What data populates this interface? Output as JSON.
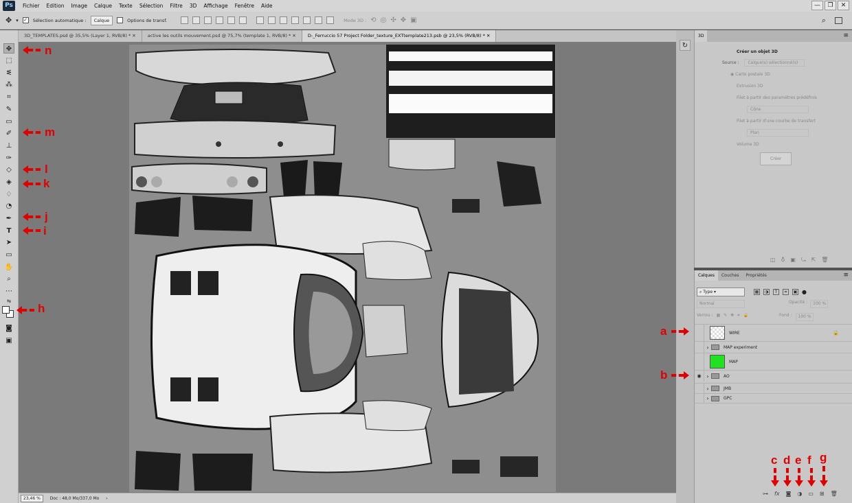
{
  "app": {
    "logo": "Ps"
  },
  "menu": [
    "Fichier",
    "Edition",
    "Image",
    "Calque",
    "Texte",
    "Sélection",
    "Filtre",
    "3D",
    "Affichage",
    "Fenêtre",
    "Aide"
  ],
  "window_controls": [
    "—",
    "❐",
    "✕"
  ],
  "options": {
    "auto_select_label": "Sélection automatique :",
    "auto_select_target": "Calque",
    "transform_label": "Options de transf.",
    "mode3d_label": "Mode 3D :"
  },
  "tabs": [
    {
      "label": "3D_TEMPLATES.psd @ 35,5% (Layer 1, RVB/8) *",
      "active": false
    },
    {
      "label": "active les outils mouvement.psd @ 75,7% (template 1, RVB/8) *",
      "active": false
    },
    {
      "label": "D-_Ferruccio 57 Project Folder_texture_EXTtemplate213.psb @ 23,5% (RVB/8) *",
      "active": true
    }
  ],
  "status": {
    "zoom": "23,46 %",
    "doc": "Doc : 48,0 Mo/337,0 Mo"
  },
  "panel3d": {
    "tab": "3D",
    "title": "Créer un objet 3D",
    "source_label": "Source :",
    "source_value": "Calque(s) sélectionné(s)",
    "options": [
      "Carte postale 3D",
      "Extrusion 3D",
      "Filet à partir des paramètres prédéfinis"
    ],
    "preset_value": "Cône",
    "depth_label": "Filet à partir d'une courbe de transfert",
    "depth_value": "Plan",
    "volume_label": "Volume 3D",
    "create_button": "Créer"
  },
  "layers_panel": {
    "tabs": [
      "Calques",
      "Couches",
      "Propriétés"
    ],
    "filter_type": "Type",
    "blend_mode": "Normal",
    "opacity_label": "Opacité :",
    "opacity_value": "100 %",
    "lock_label": "Verrou :",
    "fill_label": "Fond :",
    "fill_value": "100 %",
    "layers": [
      {
        "name": "WIRE",
        "kind": "thumb",
        "visible": false,
        "locked": true
      },
      {
        "name": "MAP experiment",
        "kind": "group",
        "visible": false
      },
      {
        "name": "MAP",
        "kind": "thumb-green",
        "visible": false
      },
      {
        "name": "AO",
        "kind": "group",
        "visible": true
      },
      {
        "name": "JMB",
        "kind": "group",
        "visible": false
      },
      {
        "name": "GPC",
        "kind": "group",
        "visible": false
      }
    ]
  },
  "annotations": {
    "n": "n",
    "m": "m",
    "l1": "l",
    "k": "k",
    "j": "j",
    "i": "i",
    "h": "h",
    "a": "a",
    "b": "b",
    "c": "c",
    "d": "d",
    "e": "e",
    "f": "f",
    "g": "g"
  },
  "colors": {
    "accent_red": "#e00000",
    "map_green": "#22e022"
  }
}
